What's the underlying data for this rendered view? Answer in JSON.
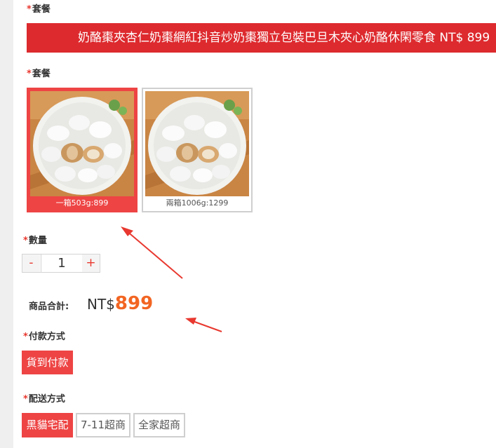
{
  "package_top": {
    "label": "套餐",
    "banner_text": "奶酪棗夾杏仁奶棗網紅抖音炒奶棗獨立包裝巴旦木夾心奶酪休閑零食 NT$ 899"
  },
  "package": {
    "label": "套餐",
    "options": [
      {
        "caption": "一箱503g:899",
        "selected": true
      },
      {
        "caption": "兩箱1006g:1299",
        "selected": false
      }
    ]
  },
  "quantity": {
    "label": "數量",
    "minus": "-",
    "value": "1",
    "plus": "+"
  },
  "subtotal": {
    "label": "商品合計:",
    "currency": "NT$",
    "amount": "899"
  },
  "payment": {
    "label": "付款方式",
    "options": [
      {
        "label": "貨到付款",
        "selected": true
      }
    ]
  },
  "delivery": {
    "label": "配送方式",
    "options": [
      {
        "label": "黑貓宅配",
        "selected": true
      },
      {
        "label": "7-11超商",
        "selected": false
      },
      {
        "label": "全家超商",
        "selected": false
      }
    ]
  },
  "required_mark": "*",
  "colors": {
    "accent": "#ee4444",
    "banner": "#dd2a2e",
    "price": "#f26522"
  }
}
